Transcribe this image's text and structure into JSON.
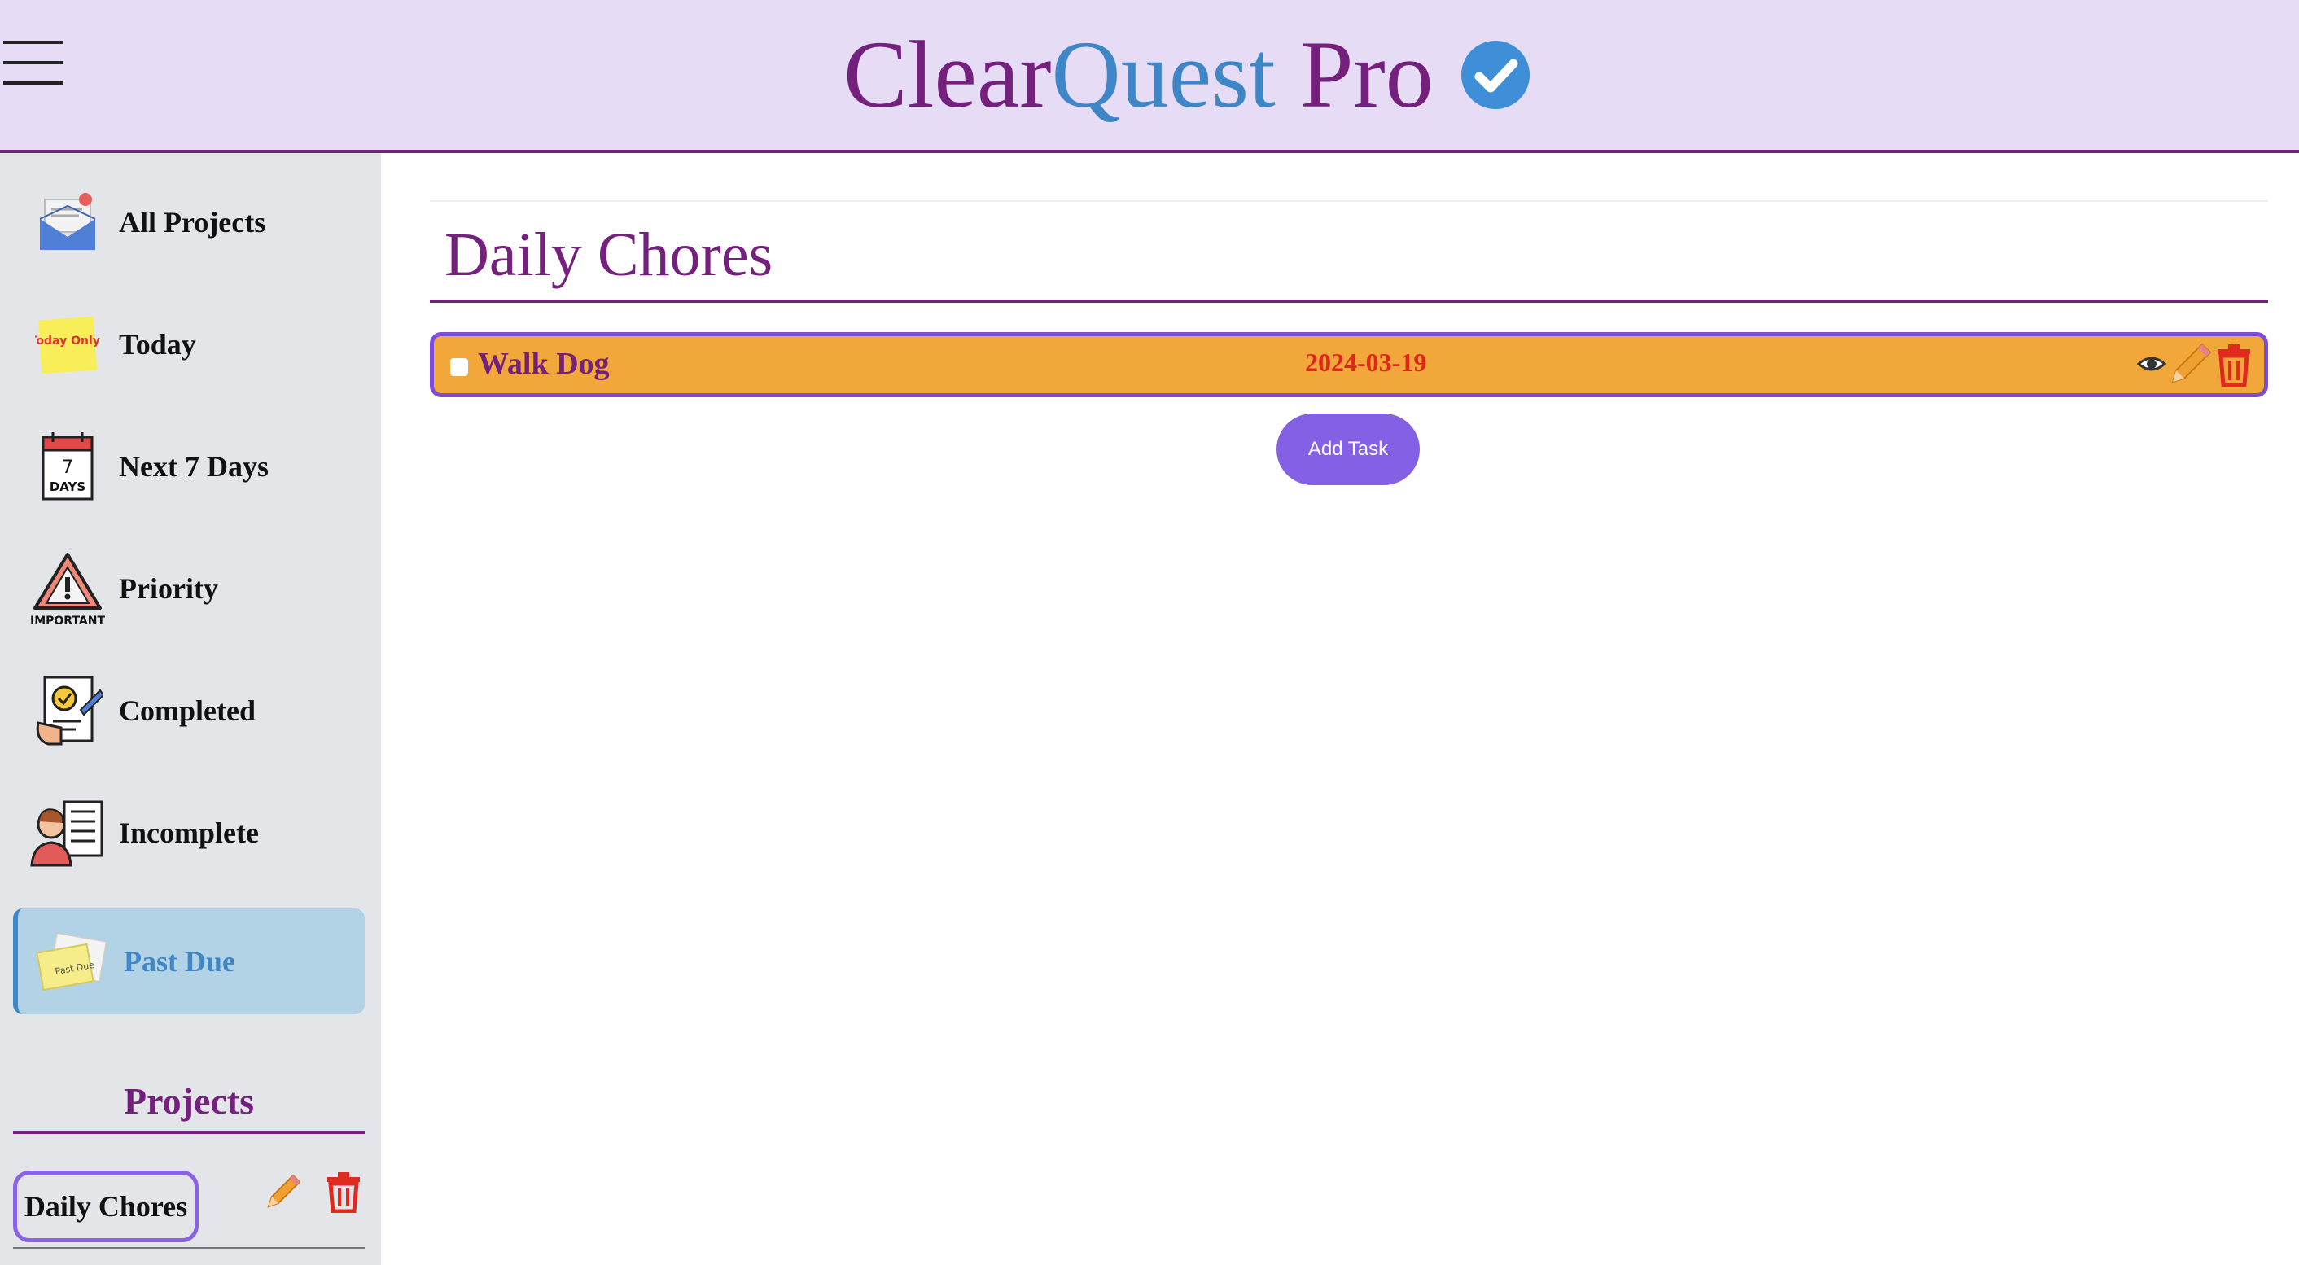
{
  "header": {
    "brand_part1": "Clear",
    "brand_part2": "Quest",
    "brand_part3": "Pro",
    "menu_icon": "hamburger-menu-icon",
    "check_icon": "verified-check-icon"
  },
  "sidebar": {
    "items": [
      {
        "label": "All Projects",
        "icon": "mail-envelope-icon"
      },
      {
        "label": "Today",
        "icon": "sticky-note-today-icon",
        "icon_text": "Today Only!"
      },
      {
        "label": "Next 7 Days",
        "icon": "calendar-7-days-icon",
        "icon_text_num": "7",
        "icon_text_days": "DAYS"
      },
      {
        "label": "Priority",
        "icon": "warning-important-icon",
        "icon_text": "IMPORTANT"
      },
      {
        "label": "Completed",
        "icon": "checklist-completed-icon"
      },
      {
        "label": "Incomplete",
        "icon": "person-checklist-icon"
      },
      {
        "label": "Past Due",
        "icon": "past-due-notes-icon",
        "icon_text": "Past Due",
        "active": true
      }
    ],
    "projects_title": "Projects",
    "projects": [
      {
        "name": "Daily Chores"
      }
    ]
  },
  "main": {
    "page_title": "Daily Chores",
    "tasks": [
      {
        "name": "Walk Dog",
        "due_date": "2024-03-19",
        "completed": false
      }
    ],
    "add_task_label": "Add Task"
  },
  "colors": {
    "brand_purple": "#74207d",
    "brand_blue": "#3f86c7",
    "header_bg": "#e7dcf6",
    "task_bg": "#f2a73b",
    "accent_violet": "#8360e4",
    "date_red": "#e0261a"
  }
}
